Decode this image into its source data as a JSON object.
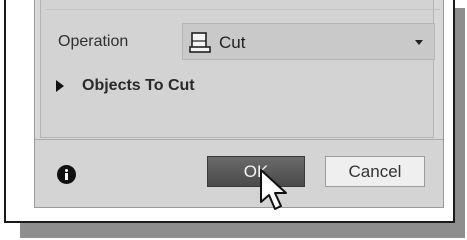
{
  "dialog": {
    "operation_label": "Operation",
    "operation_value": "Cut",
    "operation_icon": "extrude-cut-icon",
    "group_label": "Objects To Cut",
    "ok_label": "OK",
    "cancel_label": "Cancel"
  },
  "icons": {
    "info": "info-icon",
    "cursor": "mouse-pointer-icon",
    "expand": "triangle-right-icon"
  },
  "colors": {
    "ok_button": "#555555",
    "panel": "#d8d8d8"
  }
}
